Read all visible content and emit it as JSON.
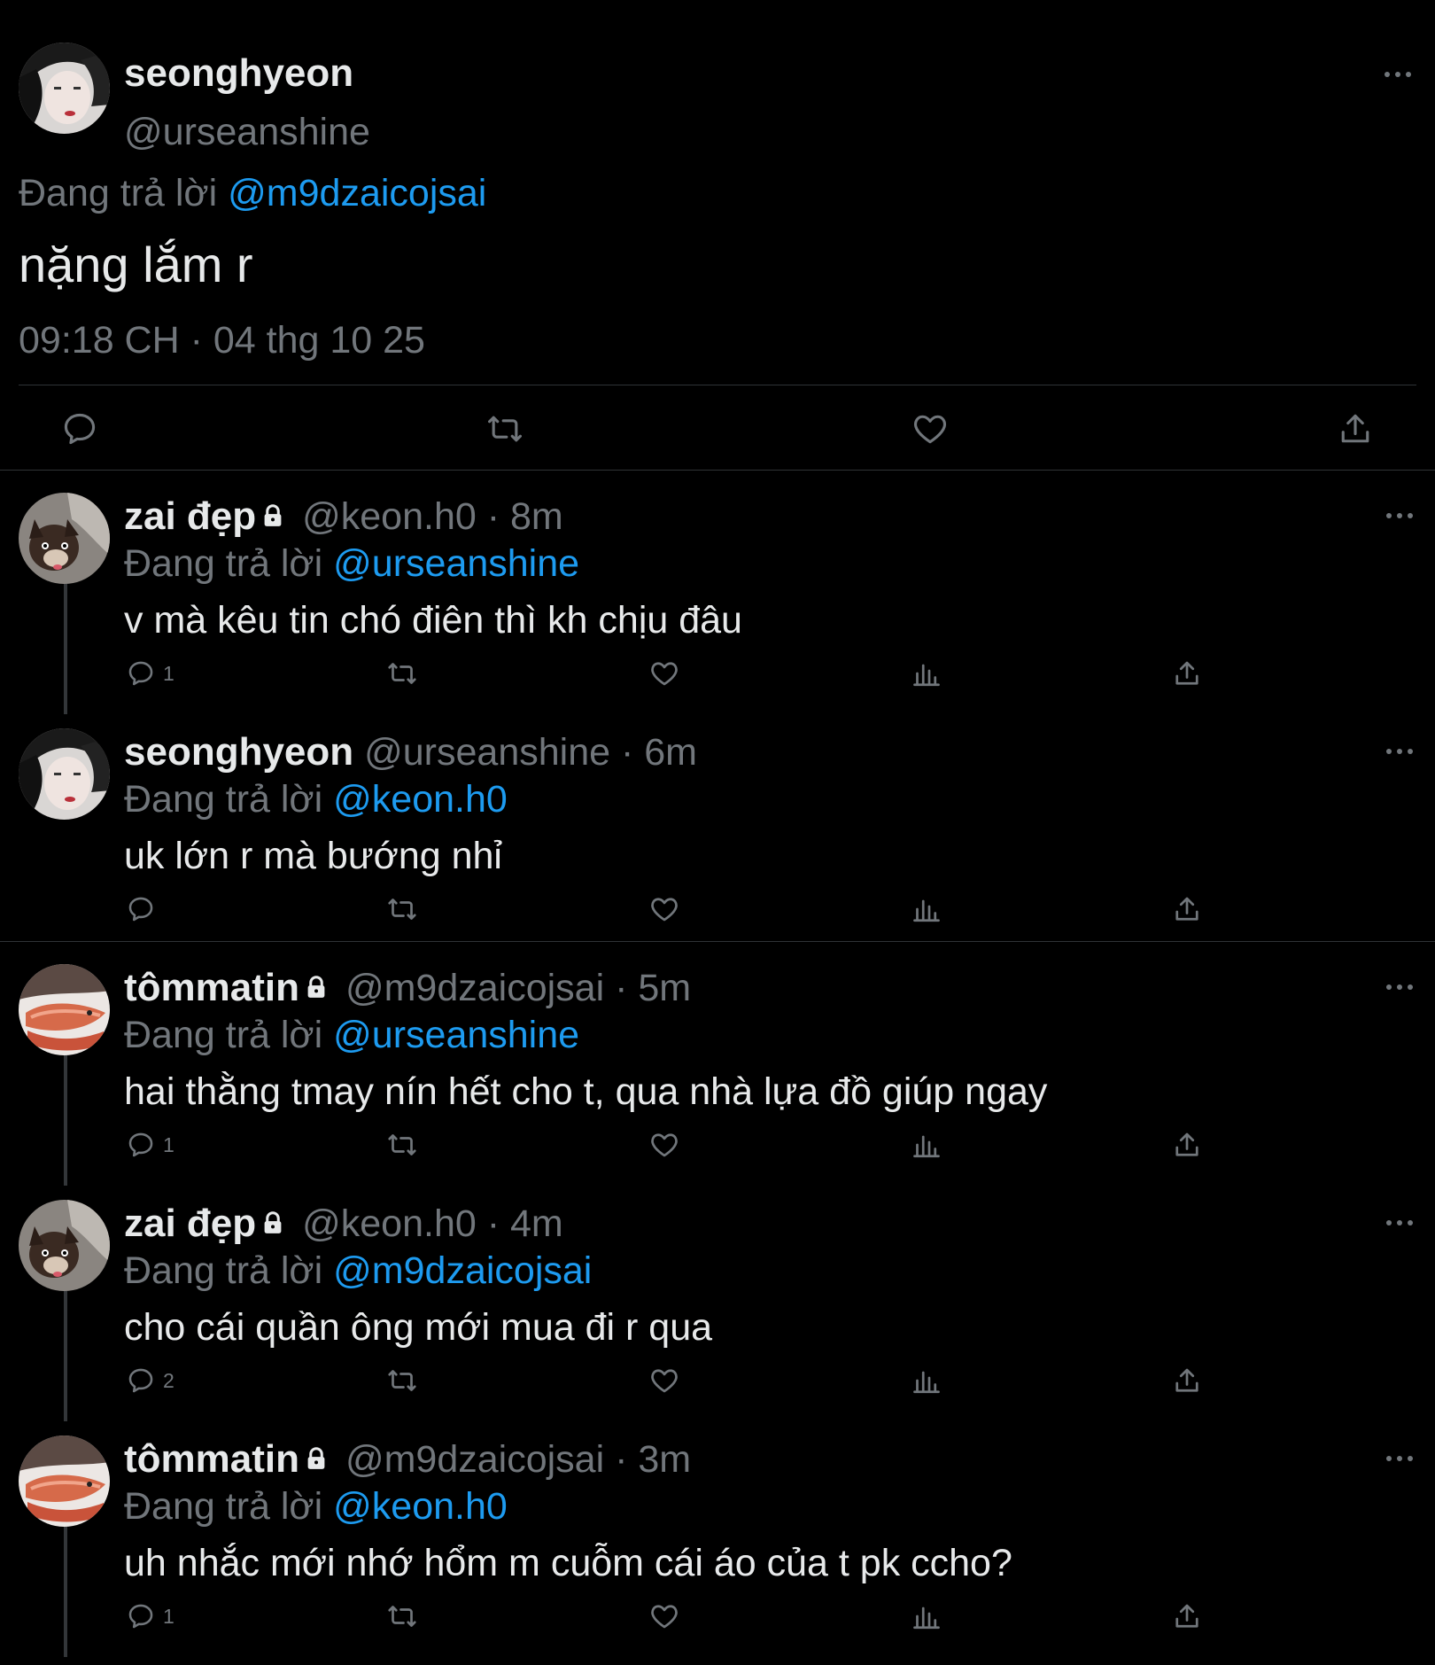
{
  "colors": {
    "background": "#000000",
    "text": "#e7e9ea",
    "secondary": "#71767b",
    "accent": "#1d9bf0",
    "divider": "#2f3336"
  },
  "main_tweet": {
    "name": "seonghyeon",
    "handle": "@urseanshine",
    "reply_prefix": "Đang trả lời",
    "reply_to": "@m9dzaicojsai",
    "text": "nặng lắm r",
    "timestamp": "09:18 CH · 04 thg 10 25",
    "actions": [
      "reply-icon",
      "retweet-icon",
      "like-icon",
      "share-icon"
    ]
  },
  "replies": [
    {
      "name": "zai đẹp",
      "locked": true,
      "handle": "@keon.h0",
      "time": "· 8m",
      "reply_prefix": "Đang trả lời",
      "reply_to": "@urseanshine",
      "text": "v mà kêu tin chó điên thì kh chịu đâu",
      "reply_count": "1",
      "avatar": "dog"
    },
    {
      "name": "seonghyeon",
      "locked": false,
      "handle": "@urseanshine",
      "time": "· 6m",
      "reply_prefix": "Đang trả lời",
      "reply_to": "@keon.h0",
      "text": "uk lớn r mà bướng nhỉ",
      "reply_count": "",
      "avatar": "girl"
    },
    {
      "name": "tômmatin",
      "locked": true,
      "handle": "@m9dzaicojsai",
      "time": "· 5m",
      "reply_prefix": "Đang trả lời",
      "reply_to": "@urseanshine",
      "text": "hai thằng tmay nín hết cho t, qua nhà lựa đồ giúp ngay",
      "reply_count": "1",
      "avatar": "shrimp"
    },
    {
      "name": "zai đẹp",
      "locked": true,
      "handle": "@keon.h0",
      "time": "· 4m",
      "reply_prefix": "Đang trả lời",
      "reply_to": "@m9dzaicojsai",
      "text": "cho cái quần ông mới mua đi r qua",
      "reply_count": "2",
      "avatar": "dog"
    },
    {
      "name": "tômmatin",
      "locked": true,
      "handle": "@m9dzaicojsai",
      "time": "· 3m",
      "reply_prefix": "Đang trả lời",
      "reply_to": "@keon.h0",
      "text": "uh nhắc mới nhớ hổm m cuỗm cái áo của t pk ccho?",
      "reply_count": "1",
      "avatar": "shrimp"
    }
  ]
}
